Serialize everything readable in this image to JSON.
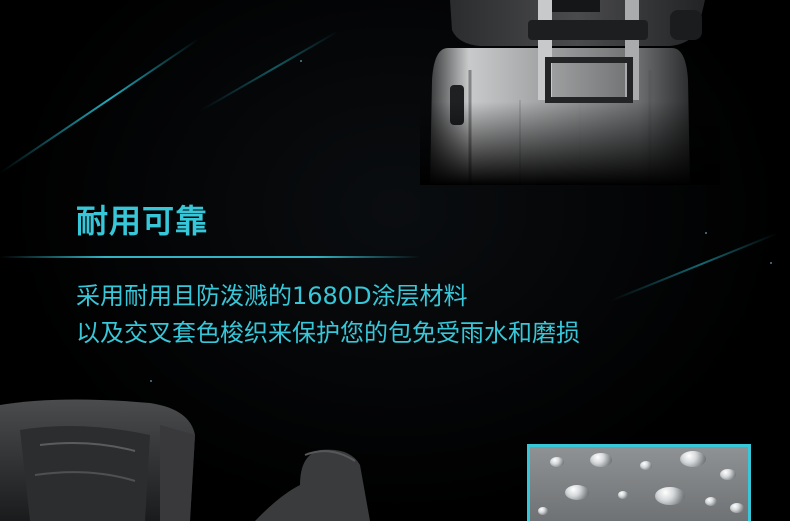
{
  "headline": "耐用可靠",
  "description": {
    "line1": "采用耐用且防泼溅的1680D涂层材料",
    "line2": "以及交叉套色梭织来保护您的包免受雨水和磨损"
  },
  "colors": {
    "accent": "#37c7d8",
    "background": "#000000"
  },
  "images": {
    "luggage": "gray hard-shell suitcase with extended trolley handle and backpack strapped on top",
    "backpack": "dark gray backpack shoulder straps close-up",
    "fabric": "water droplets on gray coated fabric"
  }
}
